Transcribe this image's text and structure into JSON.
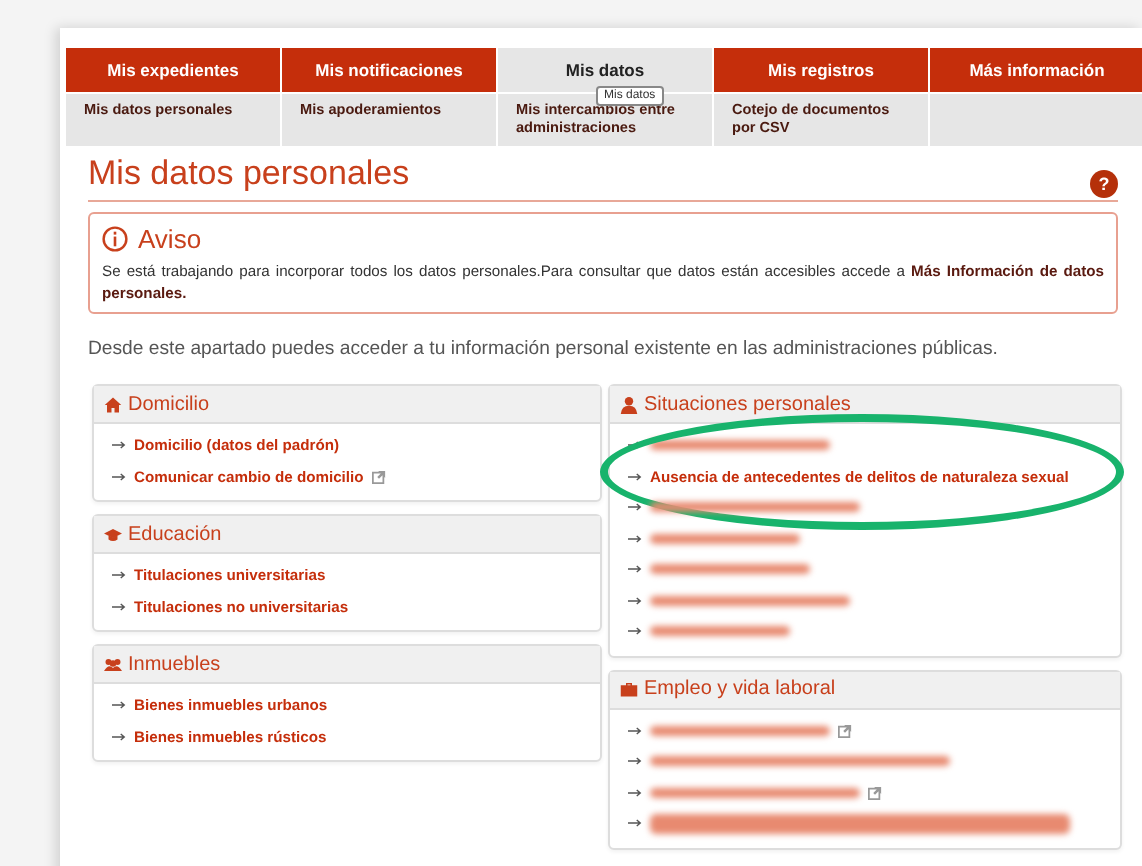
{
  "menu": {
    "tabs": [
      {
        "label": "Mis expedientes",
        "selected": false,
        "submenu": [
          "Mis datos personales"
        ]
      },
      {
        "label": "Mis notificaciones",
        "selected": false,
        "submenu": [
          "Mis apoderamientos"
        ]
      },
      {
        "label": "Mis datos",
        "selected": true,
        "tooltip": "Mis datos",
        "submenu": [
          "Mis intercambios entre administraciones"
        ]
      },
      {
        "label": "Mis registros",
        "selected": false,
        "submenu": [
          "Cotejo de documentos por CSV"
        ]
      },
      {
        "label": "Más información",
        "selected": false
      }
    ]
  },
  "page_title": "Mis datos personales",
  "help": "?",
  "notice": {
    "title": "Aviso",
    "text": "Se está trabajando para incorporar todos los datos personales.Para consultar que datos están accesibles accede a **Más Información de datos personales.**"
  },
  "intro": "Desde este apartado puedes acceder a tu información personal existente en las administraciones públicas.",
  "columns": [
    [
      {
        "title": "Domicilio",
        "items": [
          {
            "kind": "link",
            "label": "Domicilio (datos del padrón)",
            "external": false,
            "circled": false
          },
          {
            "kind": "link",
            "label": "Comunicar cambio de domicilio",
            "external": true,
            "circled": false
          }
        ]
      },
      {
        "title": "Educación",
        "items": [
          {
            "kind": "link",
            "label": "Titulaciones universitarias",
            "external": false,
            "circled": false
          },
          {
            "kind": "link",
            "label": "Titulaciones no universitarias",
            "external": false,
            "circled": false
          }
        ]
      },
      {
        "title": "Inmuebles",
        "items": [
          {
            "kind": "link",
            "label": "Bienes inmuebles urbanos",
            "external": false,
            "circled": false
          },
          {
            "kind": "link",
            "label": "Bienes inmuebles rústicos",
            "external": false,
            "circled": false
          }
        ]
      }
    ],
    [
      {
        "title": "Situaciones personales",
        "items": [
          {
            "kind": "blurred",
            "external": false,
            "circled": false
          },
          {
            "kind": "link",
            "label": "Ausencia de antecedentes de delitos de naturaleza sexual",
            "external": false,
            "circled": true
          },
          {
            "kind": "blurred",
            "external": false,
            "circled": false
          },
          {
            "kind": "blurred",
            "external": false,
            "circled": false
          },
          {
            "kind": "blurred",
            "external": false,
            "circled": false
          },
          {
            "kind": "blurred",
            "external": false,
            "circled": false
          },
          {
            "kind": "blurred",
            "external": false,
            "circled": false
          }
        ]
      },
      {
        "title": "Empleo y vida laboral",
        "items": [
          {
            "kind": "blurred",
            "external": true,
            "circled": false
          },
          {
            "kind": "blurred",
            "external": false,
            "circled": false
          },
          {
            "kind": "blurred",
            "external": true,
            "circled": false
          },
          {
            "kind": "blurred2",
            "external": false,
            "circled": false
          }
        ]
      }
    ]
  ]
}
